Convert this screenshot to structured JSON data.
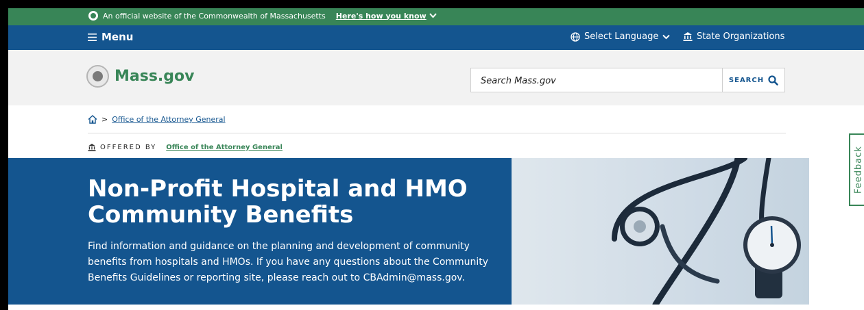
{
  "official_bar": {
    "text": "An official website of the Commonwealth of Massachusetts",
    "link": "Here's how you know"
  },
  "menubar": {
    "menu_label": "Menu",
    "language_label": "Select Language",
    "orgs_label": "State Organizations"
  },
  "header": {
    "logo_text": "Mass.gov",
    "search_placeholder": "Search Mass.gov",
    "search_button": "SEARCH"
  },
  "breadcrumb": {
    "sep": ">",
    "item": "Office of the Attorney General"
  },
  "offered_by": {
    "label": "OFFERED BY",
    "org": "Office of the Attorney General"
  },
  "feedback": {
    "label": "Feedback"
  },
  "hero": {
    "title": "Non-Profit Hospital and HMO Community Benefits",
    "description": "Find information and guidance on the planning and development of community benefits from hospitals and HMOs. If you have any questions about the Community Benefits Guidelines or reporting site, please reach out to CBAdmin@mass.gov."
  },
  "colors": {
    "green": "#388557",
    "blue": "#14558f",
    "header_bg": "#f2f2f2"
  },
  "icons": {
    "seal": "massachusetts-seal-icon",
    "chevron": "chevron-down-icon",
    "hamburger": "hamburger-icon",
    "globe": "globe-icon",
    "building": "state-building-icon",
    "search": "search-icon",
    "home": "home-icon"
  }
}
